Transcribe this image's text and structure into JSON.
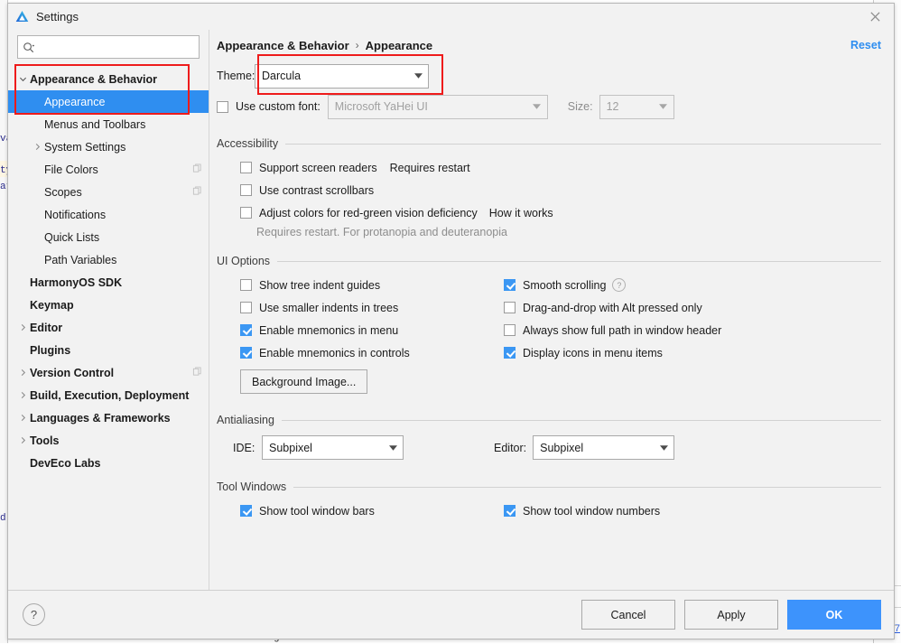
{
  "background": {
    "left_fragments": [
      "va",
      "ty",
      "at",
      "d"
    ],
    "status_text": "Moving sdk",
    "right_link": "7"
  },
  "window": {
    "title": "Settings",
    "logo_icon": "deveco-logo-icon",
    "close_icon": "close-icon"
  },
  "search": {
    "value": "",
    "placeholder": "",
    "icon": "search-icon"
  },
  "sidebar": {
    "items": [
      {
        "label": "Appearance & Behavior",
        "level": 1,
        "bold": true,
        "arrow": "chevron-down",
        "selected": false,
        "copy": false
      },
      {
        "label": "Appearance",
        "level": 2,
        "bold": false,
        "arrow": "",
        "selected": true,
        "copy": false
      },
      {
        "label": "Menus and Toolbars",
        "level": 2,
        "bold": false,
        "arrow": "",
        "selected": false,
        "copy": false
      },
      {
        "label": "System Settings",
        "level": 2,
        "bold": false,
        "arrow": "chevron-right",
        "selected": false,
        "copy": false
      },
      {
        "label": "File Colors",
        "level": 2,
        "bold": false,
        "arrow": "",
        "selected": false,
        "copy": true
      },
      {
        "label": "Scopes",
        "level": 2,
        "bold": false,
        "arrow": "",
        "selected": false,
        "copy": true
      },
      {
        "label": "Notifications",
        "level": 2,
        "bold": false,
        "arrow": "",
        "selected": false,
        "copy": false
      },
      {
        "label": "Quick Lists",
        "level": 2,
        "bold": false,
        "arrow": "",
        "selected": false,
        "copy": false
      },
      {
        "label": "Path Variables",
        "level": 2,
        "bold": false,
        "arrow": "",
        "selected": false,
        "copy": false
      },
      {
        "label": "HarmonyOS SDK",
        "level": 1,
        "bold": true,
        "arrow": "",
        "selected": false,
        "copy": false
      },
      {
        "label": "Keymap",
        "level": 1,
        "bold": true,
        "arrow": "",
        "selected": false,
        "copy": false
      },
      {
        "label": "Editor",
        "level": 1,
        "bold": true,
        "arrow": "chevron-right",
        "selected": false,
        "copy": false
      },
      {
        "label": "Plugins",
        "level": 1,
        "bold": true,
        "arrow": "",
        "selected": false,
        "copy": false
      },
      {
        "label": "Version Control",
        "level": 1,
        "bold": true,
        "arrow": "chevron-right",
        "selected": false,
        "copy": true
      },
      {
        "label": "Build, Execution, Deployment",
        "level": 1,
        "bold": true,
        "arrow": "chevron-right",
        "selected": false,
        "copy": false
      },
      {
        "label": "Languages & Frameworks",
        "level": 1,
        "bold": true,
        "arrow": "chevron-right",
        "selected": false,
        "copy": false
      },
      {
        "label": "Tools",
        "level": 1,
        "bold": true,
        "arrow": "chevron-right",
        "selected": false,
        "copy": false
      },
      {
        "label": "DevEco Labs",
        "level": 1,
        "bold": true,
        "arrow": "",
        "selected": false,
        "copy": false
      }
    ]
  },
  "breadcrumb": {
    "root": "Appearance & Behavior",
    "separator": "›",
    "leaf": "Appearance",
    "reset_label": "Reset"
  },
  "theme": {
    "label": "Theme:",
    "value": "Darcula"
  },
  "custom_font": {
    "checkbox_label": "Use custom font:",
    "checked": false,
    "font_value": "Microsoft YaHei UI",
    "size_label": "Size:",
    "size_value": "12",
    "disabled": true
  },
  "accessibility": {
    "title": "Accessibility",
    "items": [
      {
        "label": "Support screen readers",
        "checked": false,
        "note": "Requires restart",
        "link": ""
      },
      {
        "label": "Use contrast scrollbars",
        "checked": false,
        "note": "",
        "link": ""
      },
      {
        "label": "Adjust colors for red-green vision deficiency",
        "checked": false,
        "note": "",
        "link": "How it works"
      }
    ],
    "hint": "Requires restart. For protanopia and deuteranopia"
  },
  "ui_options": {
    "title": "UI Options",
    "left": [
      {
        "label": "Show tree indent guides",
        "checked": false,
        "help": false
      },
      {
        "label": "Use smaller indents in trees",
        "checked": false,
        "help": false
      },
      {
        "label": "Enable mnemonics in menu",
        "checked": true,
        "help": false
      },
      {
        "label": "Enable mnemonics in controls",
        "checked": true,
        "help": false
      }
    ],
    "right": [
      {
        "label": "Smooth scrolling",
        "checked": true,
        "help": true
      },
      {
        "label": "Drag-and-drop with Alt pressed only",
        "checked": false,
        "help": false
      },
      {
        "label": "Always show full path in window header",
        "checked": false,
        "help": false
      },
      {
        "label": "Display icons in menu items",
        "checked": true,
        "help": false
      }
    ],
    "background_image_button": "Background Image..."
  },
  "antialiasing": {
    "title": "Antialiasing",
    "ide_label": "IDE:",
    "ide_value": "Subpixel",
    "editor_label": "Editor:",
    "editor_value": "Subpixel"
  },
  "tool_windows": {
    "title": "Tool Windows",
    "left": [
      {
        "label": "Show tool window bars",
        "checked": true
      }
    ],
    "right": [
      {
        "label": "Show tool window numbers",
        "checked": true
      }
    ]
  },
  "footer": {
    "help_icon": "question-mark-icon",
    "cancel": "Cancel",
    "apply": "Apply",
    "ok": "OK"
  },
  "colors": {
    "accent_blue": "#3d93fc",
    "selection_blue": "#2f8ef0",
    "checkbox_blue": "#3b97f3",
    "annotation_red": "#ee1b1b",
    "link_blue": "#4a9ae8",
    "dialog_bg": "#f2f2f2"
  }
}
